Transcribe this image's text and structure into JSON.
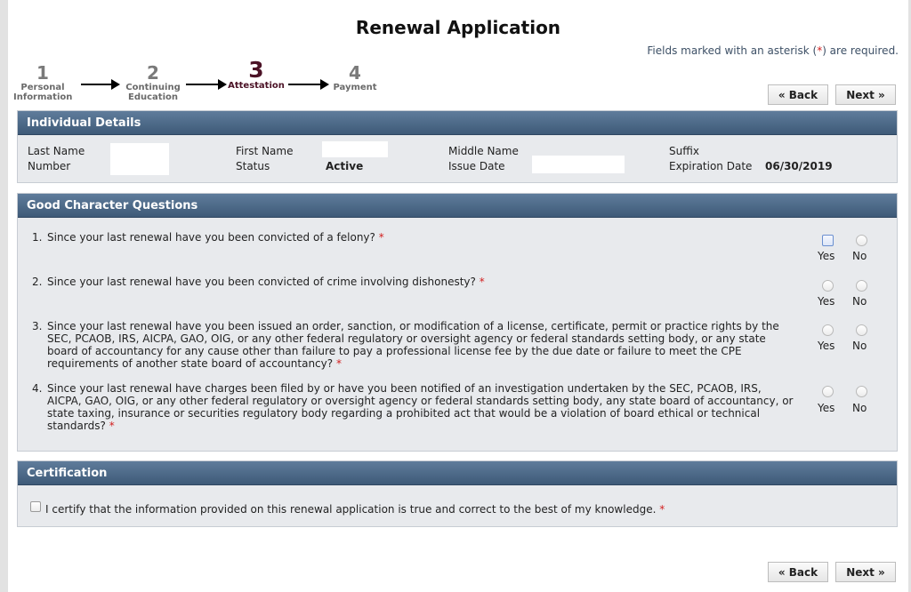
{
  "title": "Renewal Application",
  "required_note": {
    "prefix": "Fields marked with an asterisk (",
    "asterisk": "*",
    "suffix": ") are required."
  },
  "steps": [
    {
      "num": "1",
      "label_line1": "Personal",
      "label_line2": "Information"
    },
    {
      "num": "2",
      "label_line1": "Continuing",
      "label_line2": "Education"
    },
    {
      "num": "3",
      "label_line1": "Attestation",
      "label_line2": ""
    },
    {
      "num": "4",
      "label_line1": "Payment",
      "label_line2": ""
    }
  ],
  "buttons": {
    "back": "« Back",
    "next": "Next »"
  },
  "individual": {
    "header": "Individual Details",
    "last_name_label": "Last Name",
    "number_label": "Number",
    "first_name_label": "First Name",
    "status_label": "Status",
    "status_value": "Active",
    "middle_name_label": "Middle Name",
    "issue_date_label": "Issue Date",
    "suffix_label": "Suffix",
    "expiration_label": "Expiration Date",
    "expiration_value": "06/30/2019"
  },
  "character": {
    "header": "Good Character Questions",
    "yes": "Yes",
    "no": "No",
    "asterisk": "*",
    "questions": [
      {
        "n": "1.",
        "text": "Since your last renewal have you been convicted of a felony?"
      },
      {
        "n": "2.",
        "text": "Since your last renewal have you been convicted of crime involving dishonesty?"
      },
      {
        "n": "3.",
        "text": "Since your last renewal have you been issued an order, sanction, or modification of a license, certificate, permit or practice rights by the SEC, PCAOB, IRS, AICPA, GAO, OIG, or any other federal regulatory or oversight agency or federal standards setting body, or any state board of accountancy for any cause other than failure to pay a professional license fee by the due date or failure to meet the CPE requirements of another state board of accountancy?"
      },
      {
        "n": "4.",
        "text": "Since your last renewal have charges been filed by or have you been notified of an investigation undertaken by the SEC, PCAOB, IRS, AICPA, GAO, OIG, or any other federal regulatory or oversight agency or federal standards setting body, any state board of accountancy, or state taxing, insurance or securities regulatory body regarding a prohibited act that would be a violation of board ethical or technical standards?"
      }
    ]
  },
  "certification": {
    "header": "Certification",
    "text": "I certify that the information provided on this renewal application is true and correct to the best of my knowledge.",
    "asterisk": "*"
  }
}
